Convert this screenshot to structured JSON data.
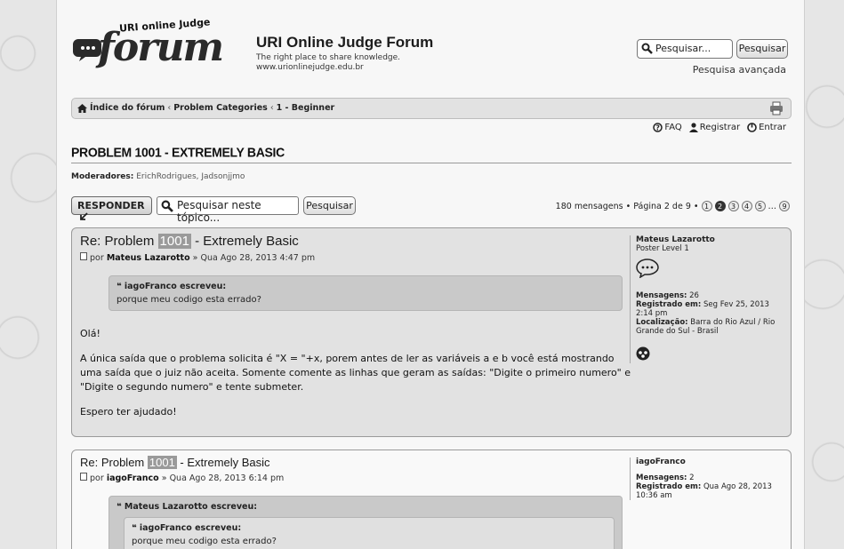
{
  "site": {
    "logo_small": "URI online Judge",
    "logo_big": "forum",
    "title": "URI Online Judge Forum",
    "tagline": "The right place to share knowledge.",
    "url": "www.urionlinejudge.edu.br"
  },
  "search": {
    "placeholder": "Pesquisar...",
    "button": "Pesquisar",
    "advanced": "Pesquisa avançada"
  },
  "breadcrumb": {
    "items": [
      "Índice do fórum",
      "Problem Categories",
      "1 - Beginner"
    ],
    "separator": "‹"
  },
  "userlinks": {
    "faq": "FAQ",
    "register": "Registrar",
    "login": "Entrar"
  },
  "topic": {
    "title": "PROBLEM 1001 - EXTREMELY BASIC",
    "moderators_label": "Moderadores:",
    "moderators": "ErichRodrigues, Jadsonjjmo"
  },
  "actions": {
    "reply": "RESPONDER",
    "topic_search_placeholder": "Pesquisar neste tópico...",
    "topic_search_button": "Pesquisar"
  },
  "pagination": {
    "summary": "180 mensagens • Página 2 de 9 •",
    "pages": [
      "1",
      "2",
      "3",
      "4",
      "5"
    ],
    "active": "2",
    "ellipsis": "…",
    "last": "9"
  },
  "posts": [
    {
      "title_prefix": "Re: Problem ",
      "title_hl": "1001",
      "title_suffix": " - Extremely Basic",
      "meta_by": "por",
      "author": "Mateus Lazarotto",
      "date": "» Qua Ago 28, 2013 4:47 pm",
      "quote_author": "iagoFranco escreveu:",
      "quote_text": "porque meu codigo esta errado?",
      "paragraphs": [
        "Olá!",
        "A única saída que o problema solicita é \"X = \"+x, porem antes de ler as variáveis a e b você está mostrando uma saída que o juiz não aceita. Somente comente as linhas que geram as saídas: \"Digite o primeiro numero\" e \"Digite o segundo numero\" e tente submeter.",
        "Espero ter ajudado!"
      ],
      "profile": {
        "name": "Mateus Lazarotto",
        "rank": "Poster Level 1",
        "posts_label": "Mensagens:",
        "posts": "26",
        "registered_label": "Registrado em:",
        "registered": "Seg Fev 25, 2013 2:14 pm",
        "location_label": "Localização:",
        "location": "Barra do Rio Azul / Rio Grande do Sul - Brasil"
      }
    },
    {
      "title_prefix": "Re: Problem ",
      "title_hl": "1001",
      "title_suffix": " - Extremely Basic",
      "meta_by": "por",
      "author": "iagoFranco",
      "date": "» Qua Ago 28, 2013 6:14 pm",
      "quote_author": "Mateus Lazarotto escreveu:",
      "inner_quote_author": "iagoFranco escreveu:",
      "inner_quote_text": "porque meu codigo esta errado?",
      "profile": {
        "name": "iagoFranco",
        "posts_label": "Mensagens:",
        "posts": "2",
        "registered_label": "Registrado em:",
        "registered": "Qua Ago 28, 2013 10:36 am"
      }
    }
  ]
}
